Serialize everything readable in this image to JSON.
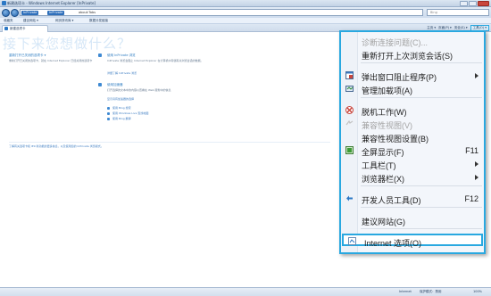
{
  "window": {
    "title": "新建选项卡 - Windows Internet Explorer [InPrivate]"
  },
  "address": {
    "pill1": "InPrivate",
    "pill2": "InPrivate",
    "url": "about:Tabs",
    "search_placeholder": "Bing"
  },
  "favorites": [
    "收藏夹",
    "建议网站 ▾",
    "网页快讯库 ▾",
    "数据分发链接"
  ],
  "tab": {
    "label": "新建选项卡"
  },
  "command_bar": [
    "主页 ▾",
    "页面(P) ▾",
    "安全(S) ▾",
    "工具(O) ▾"
  ],
  "page": {
    "heading": "接下来您想做什么？",
    "reopen_title": "重新打开已关闭的选项卡 ▾",
    "reopen_desc1": "重新打开已关闭的选项卡，就在 Internet Explorer 已经关闭的选项卡",
    "inprivate_title": "使用 InPrivate 浏览",
    "inprivate_desc1": "InPrivate 浏览会阻止 Internet Explorer 在计算机中存储有关浏览会话的数据。",
    "inprivate_link": "详细了解 InPrivate 浏览",
    "accel_title": "使用加速器",
    "accel_desc1": "打开选择的文本中的内容以查看在 Web 服务中的信息",
    "accel_link": "显示具有加速器的选择",
    "accel_items": [
      "使用 Bing 搜索",
      "使用 Windows Live 查找地图",
      "使用 Bing 翻译"
    ],
    "bottom_note": "了解有关选项卡和 IE9 新功能的更多信息，以及使用您的 InPrivate 浏览模式。"
  },
  "status": {
    "zone": "Internet",
    "mode": "保护模式：禁用",
    "zoom": "100%"
  },
  "menu": {
    "items": [
      {
        "label": "诊断连接问题(C)...",
        "disabled": true
      },
      {
        "label": "重新打开上次浏览会话(S)"
      },
      {
        "label": "弹出窗口阻止程序(P)",
        "submenu": true
      },
      {
        "label": "管理加载项(A)"
      },
      {
        "label": "脱机工作(W)"
      },
      {
        "label": "兼容性视图(V)",
        "disabled": true
      },
      {
        "label": "兼容性视图设置(B)"
      },
      {
        "label": "全屏显示(F)",
        "shortcut": "F11"
      },
      {
        "label": "工具栏(T)",
        "submenu": true
      },
      {
        "label": "浏览器栏(X)",
        "submenu": true
      },
      {
        "label": "开发人员工具(D)",
        "shortcut": "F12"
      },
      {
        "label": "建议网站(G)"
      },
      {
        "label": "Internet 选项(O)"
      }
    ],
    "icons": [
      "popup-blocker-icon",
      "addons-icon",
      "offline-icon",
      "fullscreen-icon",
      "developer-tools-icon",
      "internet-options-icon"
    ],
    "accent": "#29a8e0"
  }
}
